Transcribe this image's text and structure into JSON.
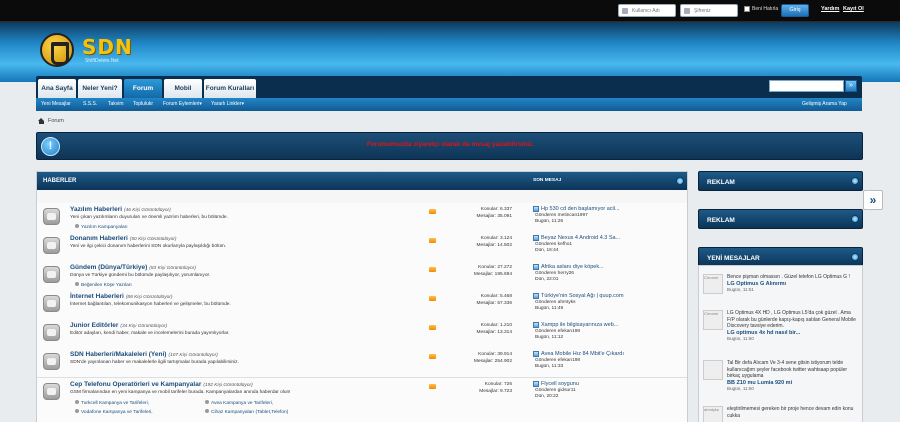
{
  "topbar": {
    "username_placeholder": "Kullanıcı Adı",
    "password_placeholder": "Şifreniz",
    "remember_label": "Beni Hatırla",
    "login_button": "Giriş",
    "forgot_link": "Yardım",
    "register_link": "Kayıt Ol"
  },
  "logo": {
    "name": "SDN",
    "tagline": "ShiftDelete.Net"
  },
  "nav": {
    "tabs": [
      {
        "label": "Ana Sayfa"
      },
      {
        "label": "Neler Yeni?"
      },
      {
        "label": "Forum"
      },
      {
        "label": "Mobil"
      },
      {
        "label": "Forum Kuralları"
      }
    ],
    "active_tab": "Forum",
    "search_button": "»"
  },
  "subnav": {
    "links": [
      {
        "label": "Yeni Mesajlar"
      },
      {
        "label": "S.S.S."
      },
      {
        "label": "Takvim"
      },
      {
        "label": "Toplulukr"
      },
      {
        "label": "Forum Eylemleri▾"
      },
      {
        "label": "Yararlı Linkler▾"
      }
    ],
    "advanced_search": "Gelişmiş Arama Yap"
  },
  "breadcrumb": {
    "label": "Forum"
  },
  "notice": {
    "icon": "!",
    "text": "Forumumuzda ziyaretçi olarak da mesaj yazabilirsiniz."
  },
  "forum": {
    "section_title": "HABERLER",
    "last_post_header": "SON MESAJ",
    "rows": [
      {
        "title": "Yazılım Haberleri",
        "viewers": "(46 Kişi Görüntülüyor)",
        "desc": "Yeni çıkan yazılımların duyuruları ve önemli yazılım haberleri, bu bölümde.",
        "subs": [
          "Yazılım Kampanyaları"
        ],
        "topics": "Konular: 6.337",
        "posts": "Mesajlar: 35.091",
        "last_title": "Hp 530 cd den başlamıyor acil...",
        "last_by": "Gönderen metincan1997",
        "last_time": "Bugün, 11:26"
      },
      {
        "title": "Donanım Haberleri",
        "viewers": "(50 Kişi Görüntülüyor)",
        "desc": "Yeni ve ilgi çekici donanım haberlerini SDN okurlarıyla paylaşıldığı bölüm.",
        "subs": [],
        "topics": "Konular: 3.124",
        "posts": "Mesajlar: 14.502",
        "last_title": "Beyaz Nexus 4 Android 4.3 Sa...",
        "last_by": "Gönderen kefho1",
        "last_time": "Dün, 16:44"
      },
      {
        "title": "Gündem (Dünya/Türkiye)",
        "viewers": "(83 Kişi Görüntülüyor)",
        "desc": "Dünya ve Türkiye gündemi bu bölümde paylaşılıyor, yorumlanıyor.",
        "subs": [
          "Beğenilen Köşe Yazıları"
        ],
        "topics": "Konular: 27.272",
        "posts": "Mesajlar: 195.694",
        "last_title": "Afrika aslanı diye köpek...",
        "last_by": "Gönderen herry26",
        "last_time": "Dün, 22:01"
      },
      {
        "title": "İnternet Haberleri",
        "viewers": "(88 Kişi Görüntülüyor)",
        "desc": "İnternet bağlantıları, telekomunikasyon haberleri ve gelişmeler, bu bölümde.",
        "subs": [],
        "topics": "Konular: 5.468",
        "posts": "Mesajlar: 57.336",
        "last_title": "Türkiye'nin Sosyal Ağı | quup.com",
        "last_by": "Gönderen ahmtyks",
        "last_time": "Bugün, 11:49"
      },
      {
        "title": "Junior Editörler",
        "viewers": "(34 Kişi Görüntülüyor)",
        "desc": "Editör adayları, kendi haber, makale ve incelemelerini burada yayımlıyorlar.",
        "subs": [],
        "topics": "Konular: 1.210",
        "posts": "Mesajlar: 13.314",
        "last_title": "Xampp ile bilgisayarınıza web...",
        "last_by": "Gönderen efekan198",
        "last_time": "Bugün, 11:12"
      },
      {
        "title": "SDN Haberleri/Makaleleri (Yeni)",
        "viewers": "(107 Kişi Görüntülüyor)",
        "desc": "SDN'de yayınlanan haber ve makalelerle ilgili tartışmalar burada yapılabilirsiniz.",
        "subs": [],
        "topics": "Konular: 39.914",
        "posts": "Mesajlar: 254.902",
        "last_title": "Avea Mobile Hız 84 Mbit'e Çıkardı",
        "last_by": "Gönderen efekan198",
        "last_time": "Bugün, 11:33"
      },
      {
        "title": "Cep Telefonu Operatörleri ve Kampanyalar",
        "viewers": "(192 Kişi Görüntülüyor)",
        "desc": "GSM firmalarından en yeni kampanya ve mobil tarifeler burada. Kampanyalardan anında haberdar olun!",
        "subs": [
          "Turkcell Kampanya ve Tarifeleri,",
          "Avea Kampanya ve Tarifeleri,",
          "Vodafone Kampanya ve Tarifeleri,",
          "Cihaz Kampanyaları (Tablet,Telefon)"
        ],
        "topics": "Konular: 726",
        "posts": "Mesajlar: 9.723",
        "last_title": "Flycell soygunu",
        "last_by": "Gönderen gidsur11",
        "last_time": "Dün, 20:22"
      }
    ]
  },
  "sidebar": {
    "block1_title": "REKLAM",
    "block2_title": "REKLAM",
    "block3_title": "YENİ MESAJLAR",
    "posts": [
      {
        "avatar_alt": "Chrome",
        "text": "Bence pişman olmassın . Güzel telefon LG Optimus G !",
        "title": "LG Optimus G Alınırmı",
        "time": "Bugün, 11:51"
      },
      {
        "avatar_alt": "Chrome",
        "text": "LG Optimus 4X HD , LG Optimus L5'da çok güzel . Ama F/P olarak bu günlerde kapış-kapış satılan General Mobile Discovery tavsiye ederim.",
        "title": "LG optimus 4x hd nasıl bir...",
        "time": "Bugün, 11:50"
      },
      {
        "avatar_alt": "",
        "text": "Tal Bir defa Alıcam Ve 3-4 sene gitsin istiyorum telde kullanıcağım şeyler facebook twitter wahtsaap popüler birkaç uygulama",
        "title": "BB Z10 mu Lumia 920 mi",
        "time": "Bugün, 11:50"
      },
      {
        "avatar_alt": "ahmtyks",
        "text": "eleştirilmemesi gereken bir proje hence devam edin konu cukka",
        "title": "",
        "time": ""
      }
    ]
  },
  "colors": {
    "accent": "#1d6fb8",
    "header_blue": "#49b9ef",
    "notice_red": "#e01414",
    "dark_navy": "#0a2f4e"
  }
}
